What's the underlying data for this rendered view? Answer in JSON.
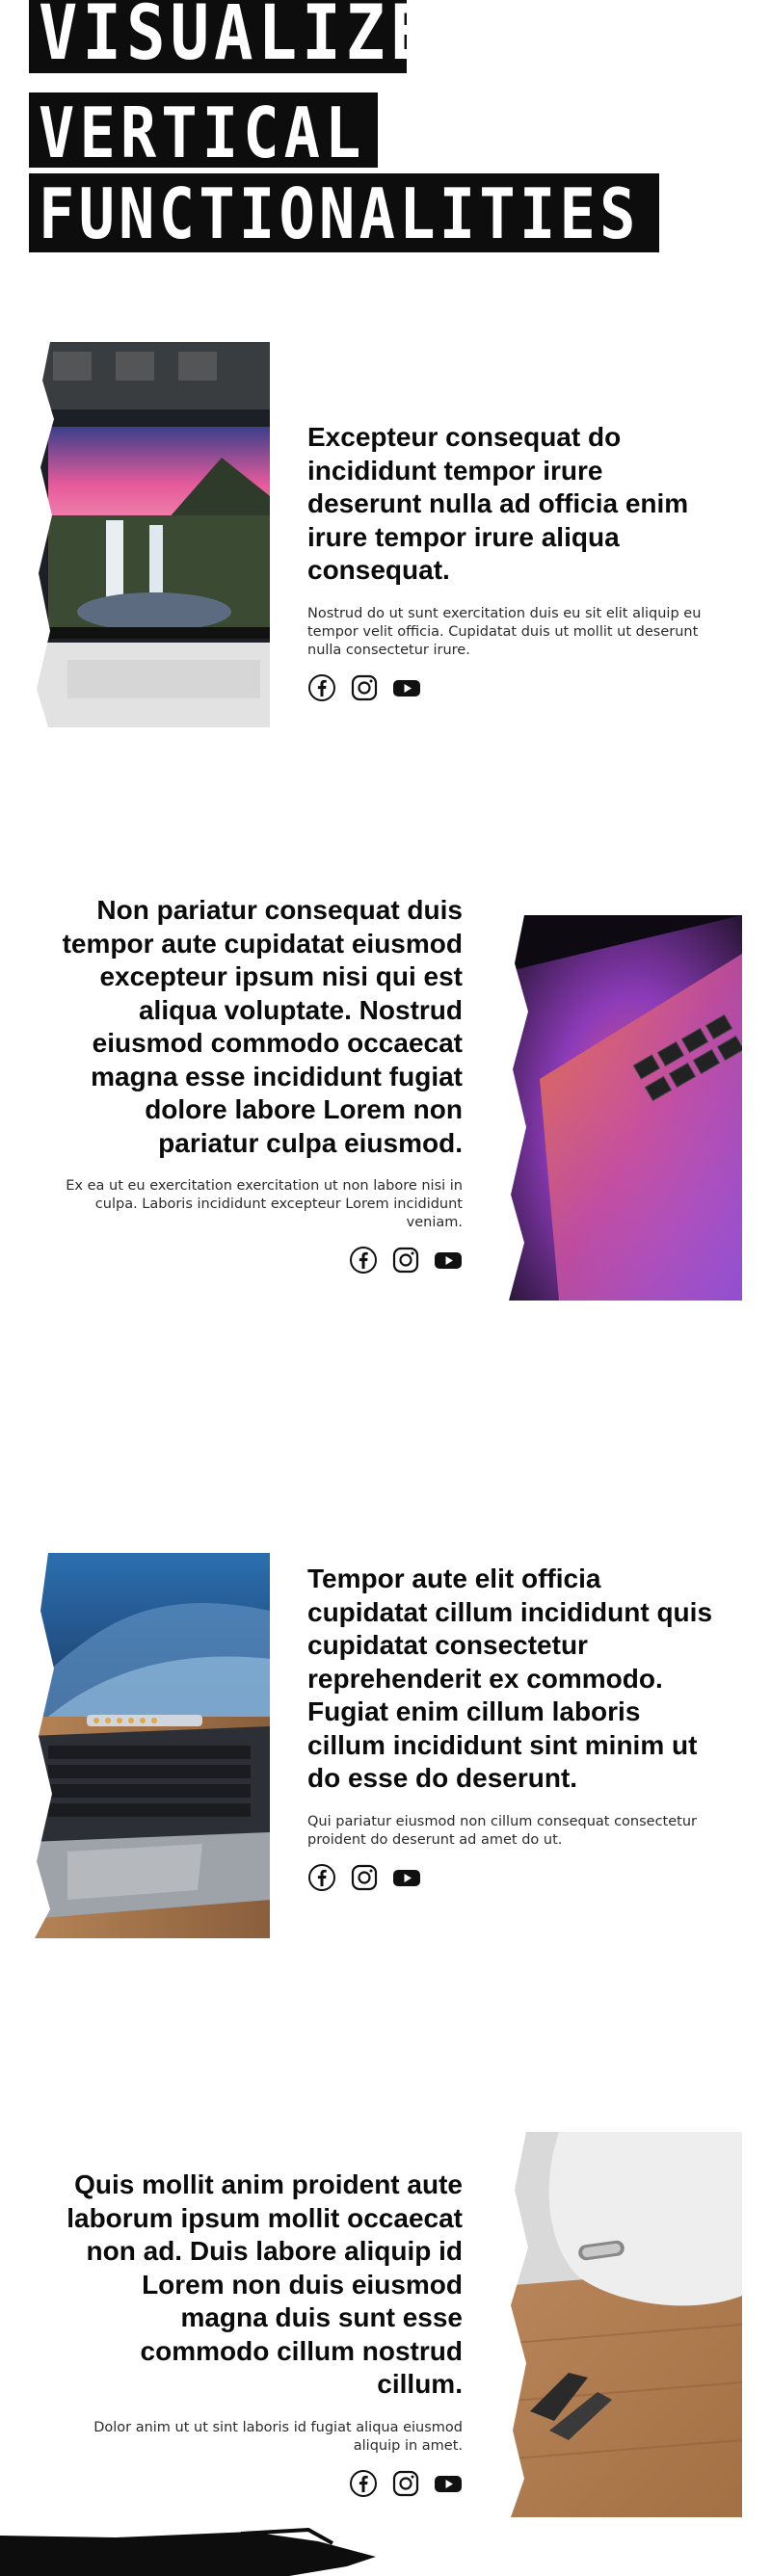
{
  "hero": {
    "line1": "VISUALIZE",
    "line2": "VERTICAL",
    "line3": "FUNCTIONALITIES"
  },
  "features": [
    {
      "heading": "Excepteur consequat do incididunt tempor irure deserunt nulla ad officia enim irure tempor irure aliqua consequat.",
      "body": "Nostrud do ut sunt exercitation duis eu sit elit aliquip eu tempor velit officia. Cupidatat duis ut mollit ut deserunt nulla consectetur irure.",
      "image_icon": "laptop-waterfall-image"
    },
    {
      "heading": "Non pariatur consequat duis tempor aute cupidatat eiusmod excepteur ipsum nisi qui est aliqua voluptate. Nostrud eiusmod commodo occaecat magna esse incididunt fugiat dolore labore Lorem non pariatur culpa eiusmod.",
      "body": "Ex ea ut eu exercitation exercitation ut non labore nisi in culpa. Laboris incididunt excepteur Lorem incididunt veniam.",
      "image_icon": "laptop-keyboard-purple-image"
    },
    {
      "heading": "Tempor aute elit officia cupidatat cillum incididunt quis cupidatat consectetur reprehenderit ex commodo. Fugiat enim cillum laboris cillum incididunt sint minim ut do esse do deserunt.",
      "body": "Qui pariatur eiusmod non cillum consequat consectetur proident do deserunt ad amet do ut.",
      "image_icon": "macbook-dunes-image"
    },
    {
      "heading": "Quis mollit anim proident aute laborum ipsum mollit occaecat non ad. Duis labore aliquip id Lorem non duis eiusmod magna duis sunt esse commodo cillum nostrud cillum.",
      "body": "Dolor anim ut ut sint laboris id fugiat aliqua eiusmod aliquip in amet.",
      "image_icon": "white-device-wood-image"
    }
  ],
  "social_icons": [
    "facebook-icon",
    "instagram-icon",
    "youtube-icon"
  ]
}
